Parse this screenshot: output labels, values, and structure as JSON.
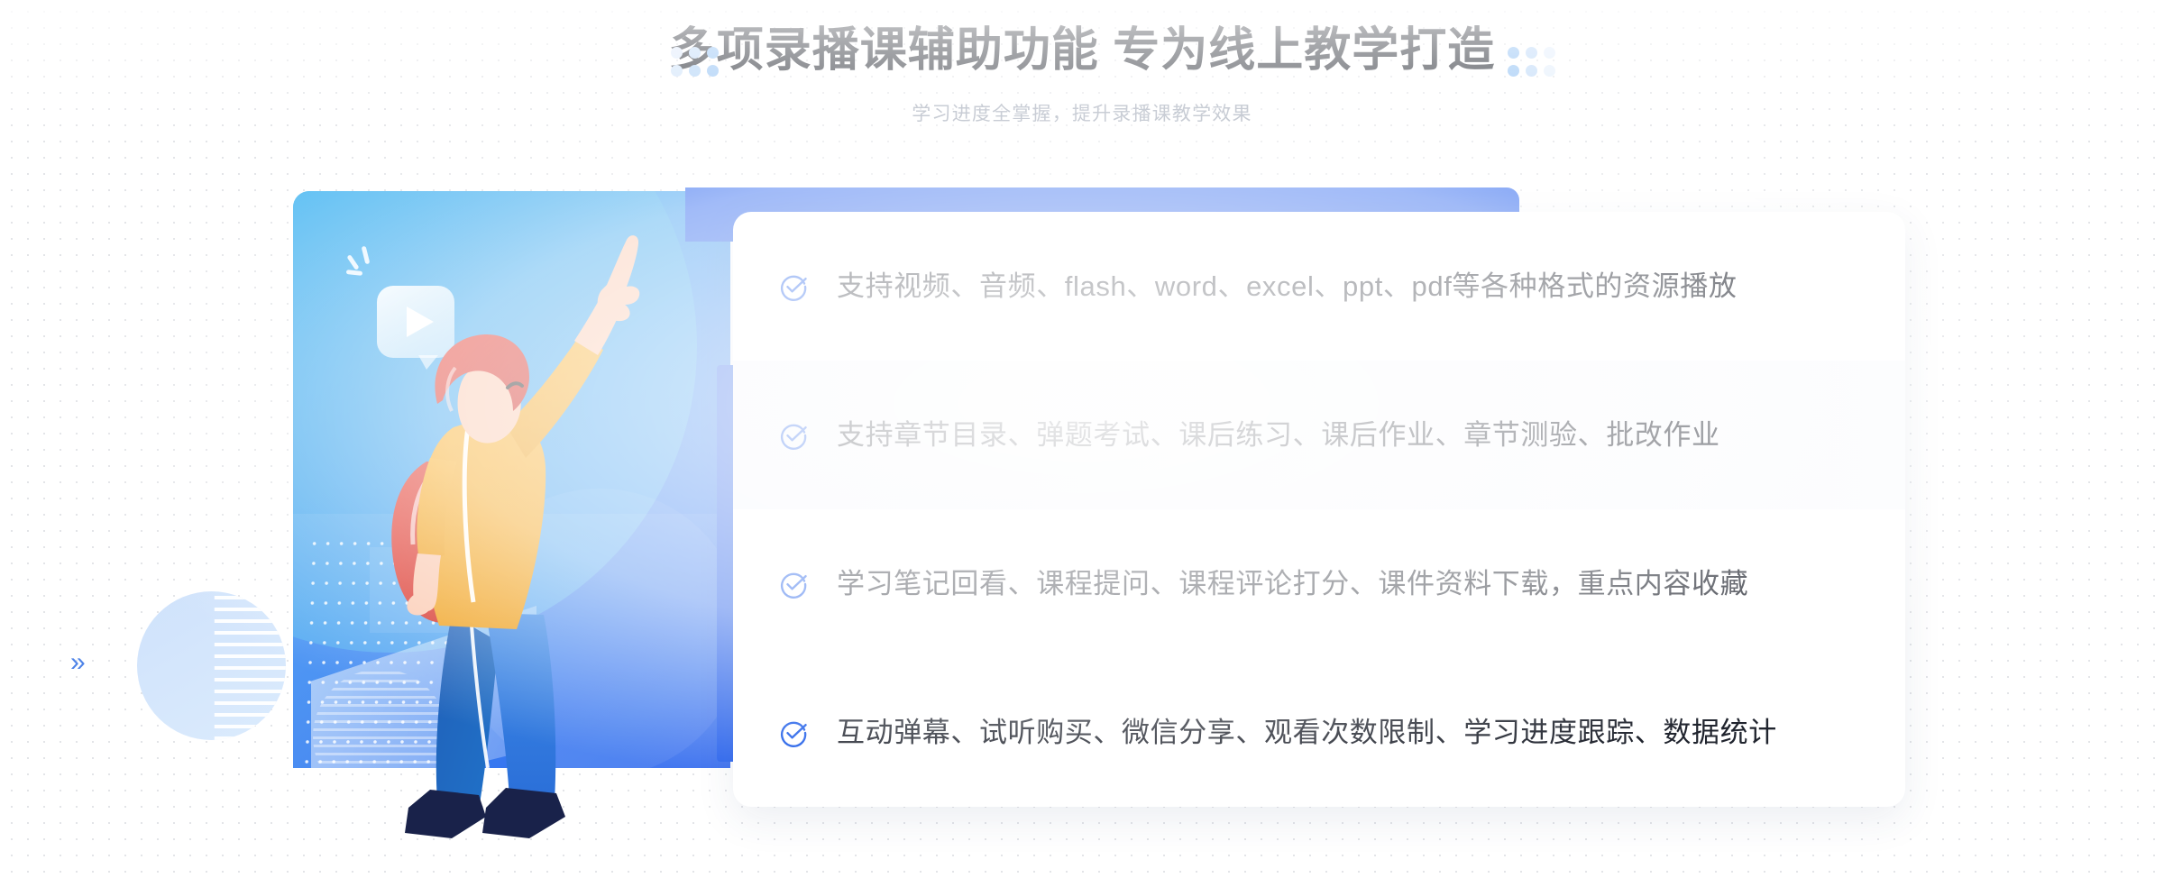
{
  "header": {
    "title": "多项录播课辅助功能 专为线上教学打造",
    "subtitle": "学习进度全掌握，提升录播课教学效果"
  },
  "icons": {
    "play": "play-icon",
    "check": "check-circle-icon",
    "chevron_left_decor": "double-chevron-left-icon",
    "chevron_right_decor": "double-chevron-right-icon",
    "decor_left_dots": "dot-grid-decoration",
    "decor_right_dots": "dot-grid-decoration"
  },
  "decorations": {
    "chevron_right_glyph": "»",
    "chevron_left_glyph": "«"
  },
  "illustration": {
    "alt": "woman-pointing-up-illustration",
    "panel_gradient_from": "#4cc3f2",
    "panel_gradient_to": "#3168ee",
    "hair_color": "#e0382f",
    "shirt_color": "#f5a623",
    "pants_color": "#2f7de0",
    "shoe_color": "#1b2a52",
    "skin_color": "#fbc9b0"
  },
  "features": [
    {
      "text": "支持视频、音频、flash、word、excel、ppt、pdf等各种格式的资源播放",
      "highlighted": false
    },
    {
      "text": "支持章节目录、弹题考试、课后练习、课后作业、章节测验、批改作业",
      "highlighted": true
    },
    {
      "text": "学习笔记回看、课程提问、课程评论打分、课件资料下载，重点内容收藏",
      "highlighted": false
    },
    {
      "text": "互动弹幕、试听购买、微信分享、观看次数限制、学习进度跟踪、数据统计",
      "highlighted": false
    }
  ],
  "colors": {
    "accent_blue": "#2f68ef",
    "check_blue": "#1a5ae8",
    "title_text": "#1b1f28",
    "subtitle_text": "#9aa2b1",
    "feature_text": "#20242e",
    "card_bg": "#ffffff",
    "page_bg": "#ffffff",
    "highlight_row_bg": "#f4f6fb"
  }
}
